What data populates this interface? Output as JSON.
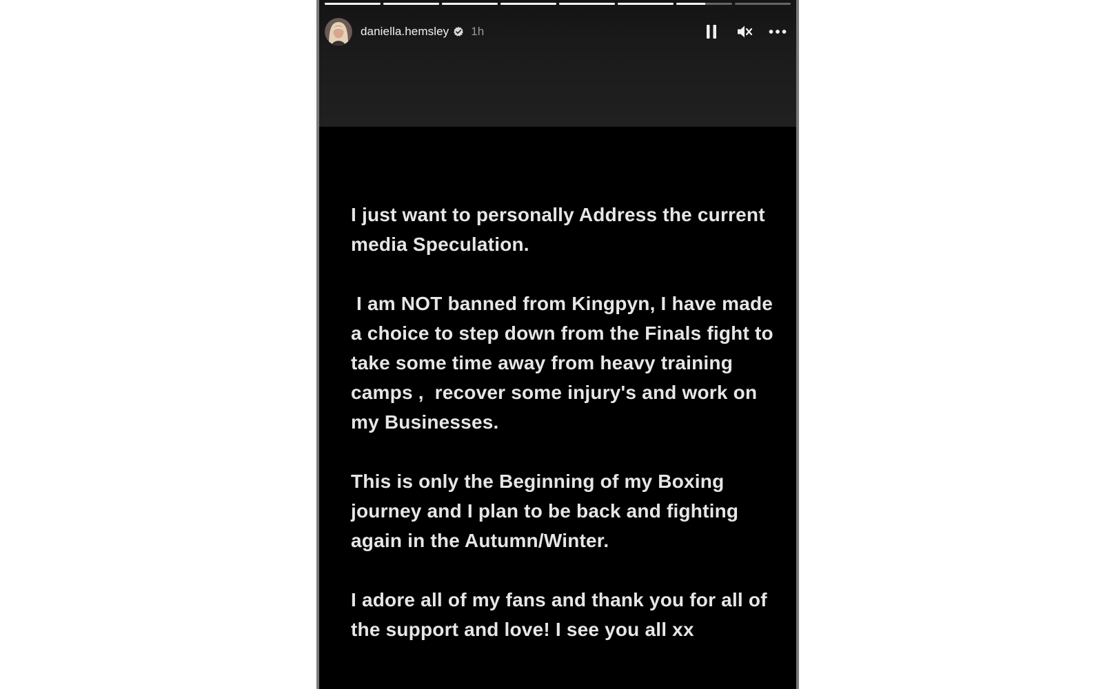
{
  "story": {
    "progress": [
      1,
      1,
      1,
      1,
      1,
      1,
      0.52,
      0
    ],
    "user": {
      "username": "daniella.hemsley",
      "verified": true,
      "time_ago": "1h"
    },
    "controls": {
      "pause_icon": "pause-icon",
      "mute_icon": "muted-speaker-icon",
      "more_icon": "more-horizontal-icon"
    },
    "message": {
      "paragraphs": [
        "I just want to personally Address the current media Speculation.",
        " I am NOT banned from Kingpyn, I have made a choice to step down from the Finals fight to take some time away from heavy training camps ,  recover some injury's and work on my Businesses.",
        "This is only the Beginning of my Boxing journey and I plan to be back and fighting again in the Autumn/Winter.",
        "I adore all of my fans and thank you for all of the support and love! I see you all xx"
      ]
    },
    "colors": {
      "background": "#000000",
      "header": "#1c1c1c",
      "text": "#e6e6e6",
      "timestamp": "#9a9a9a"
    }
  }
}
